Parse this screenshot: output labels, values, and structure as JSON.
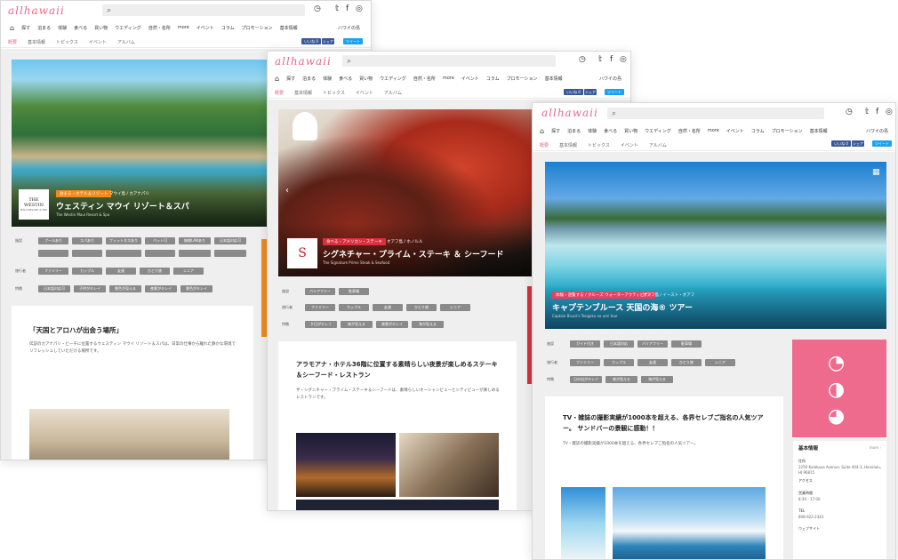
{
  "site": {
    "logo": "allhawaii",
    "nav": [
      "ホーム",
      "探す",
      "泊まる",
      "体験",
      "食べる",
      "買い物",
      "ウエディング",
      "自然・名所",
      "more",
      "イベント",
      "コラム",
      "プロモーション",
      "基本情報"
    ],
    "island_select": "ハワイの島",
    "subnav": [
      "概要",
      "基本情報",
      "トピックス",
      "イベント",
      "アルバム"
    ],
    "fb_label": "いいね 0",
    "share_label": "シェア",
    "tweet_label": "ツイート",
    "filter_labels": [
      "施設",
      "旅行者",
      "特徴"
    ]
  },
  "windows": [
    {
      "category": "泊まる › ホテル＆リゾート",
      "location": "マウイ島 / カアナパリ",
      "title": "ウェスティン マウイ リゾート＆スパ",
      "subtitle": "The Westin Maui Resort & Spa",
      "brand": "THE WESTIN",
      "brand_sub": "MAUI RESORT & SPA",
      "chips": [
        [
          "プールあり",
          "スパあり",
          "フィットネスあり",
          "ペット可",
          "無線LANあり",
          "日本語対応可"
        ],
        [
          "ファミリー",
          "カップル",
          "友達",
          "ひとり旅",
          "シニア"
        ],
        [
          "日本語対応可",
          "子供がキレイ",
          "景色が見える",
          "夜景がキレイ",
          "景色がキレイ"
        ]
      ],
      "card_title": "「天国とアロハが出会う場所」",
      "card_body": "伝説のカアナパリ・ビーチに位置するウェスティン マウイ リゾート＆スパは、日常の仕事から離れた静かな環境でリフレッシュしていただける場所です。"
    },
    {
      "category": "食べる › アメリカン・ステーキ",
      "location": "オアフ島 / ホノルル",
      "title": "シグネチャー・プライム・ステーキ ＆ シーフード",
      "subtitle": "The Signature Prime Steak & Seafood",
      "chips": [
        [
          "バリアフリー",
          "駐車場"
        ],
        [
          "ファミリー",
          "カップル",
          "友達",
          "ひとり旅",
          "シニア"
        ],
        [
          "夕日がキレイ",
          "夜が見える",
          "夜景がキレイ",
          "海が見える"
        ]
      ],
      "card_title": "アラモアナ・ホテル36階に位置する素晴らしい夜景が楽しめるステーキ＆シーフード・レストラン",
      "card_body": "ザ・シグニチャー・プライム・ステーキ＆シーフードは、素晴らしいオーシャンビューとシティビューが楽しめるレストランです。"
    },
    {
      "category": "体験 › 遊覧する / クルーズ ウォーターアクティビティ",
      "location": "オアフ島 / イースト・オアフ",
      "title": "キャプテンブルース 天国の海® ツアー",
      "subtitle": "Captain Bruce's Tengoku no umi tour",
      "chips": [
        [
          "ガイド付き",
          "日本語対応",
          "バリアフリー",
          "駐車場"
        ],
        [
          "ファミリー",
          "カップル",
          "友達",
          "ひとり旅",
          "シニア"
        ],
        [
          "日の出がキレイ",
          "夜が見える",
          "海が見える"
        ]
      ],
      "card_title": "TV・雑誌の撮影実績が1000本を超える、各界セレブご指名の人気ツアー。 サンドバーの景観に感動！！",
      "card_body": "TV・雑誌の撮影実績が1000本を超える、各界セレブご指名の人気ツアー。",
      "basic_title": "基本情報",
      "basic_more": "more ›",
      "basic_lines": [
        "住所",
        "2250 Kalakaua Avenue, Suite 404-3, Honolulu, HI 96815",
        "アクセス",
        "営業時間",
        "8:30 - 17:00",
        "TEL",
        "808-922-2343",
        "ウェブサイト"
      ]
    }
  ],
  "colors": {
    "accent": "#e46a8a",
    "fb": "#3b5998",
    "twitter": "#1da1f2",
    "chip": "#8a8a8a"
  }
}
